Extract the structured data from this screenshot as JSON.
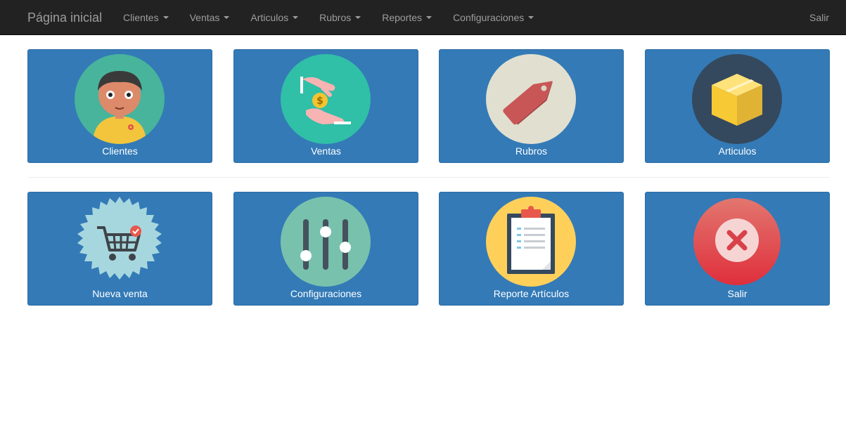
{
  "navbar": {
    "brand": "Página inicial",
    "menu": [
      {
        "label": "Clientes"
      },
      {
        "label": "Ventas"
      },
      {
        "label": "Articulos"
      },
      {
        "label": "Rubros"
      },
      {
        "label": "Reportes"
      },
      {
        "label": "Configuraciones"
      }
    ],
    "logout": "Salir"
  },
  "tiles": [
    {
      "label": "Clientes",
      "icon": "client-person-icon",
      "circle_color": "#48b49c"
    },
    {
      "label": "Ventas",
      "icon": "money-hands-icon",
      "circle_color": "#30bfa7"
    },
    {
      "label": "Rubros",
      "icon": "price-tag-icon",
      "circle_color": "#e1dfd0"
    },
    {
      "label": "Articulos",
      "icon": "box-icon",
      "circle_color": "#34495e"
    },
    {
      "label": "Nueva venta",
      "icon": "shopping-cart-icon",
      "circle_color": "#a7d7de"
    },
    {
      "label": "Configuraciones",
      "icon": "sliders-icon",
      "circle_color": "#78c2ad"
    },
    {
      "label": "Reporte Artículos",
      "icon": "clipboard-report-icon",
      "circle_color": "#fed05a"
    },
    {
      "label": "Salir",
      "icon": "close-icon",
      "circle_color": "#e0434d"
    }
  ],
  "colors": {
    "navbar_bg": "#222222",
    "nav_text": "#9d9d9d",
    "tile_bg": "#337ab7",
    "tile_border": "#2e6da4"
  }
}
